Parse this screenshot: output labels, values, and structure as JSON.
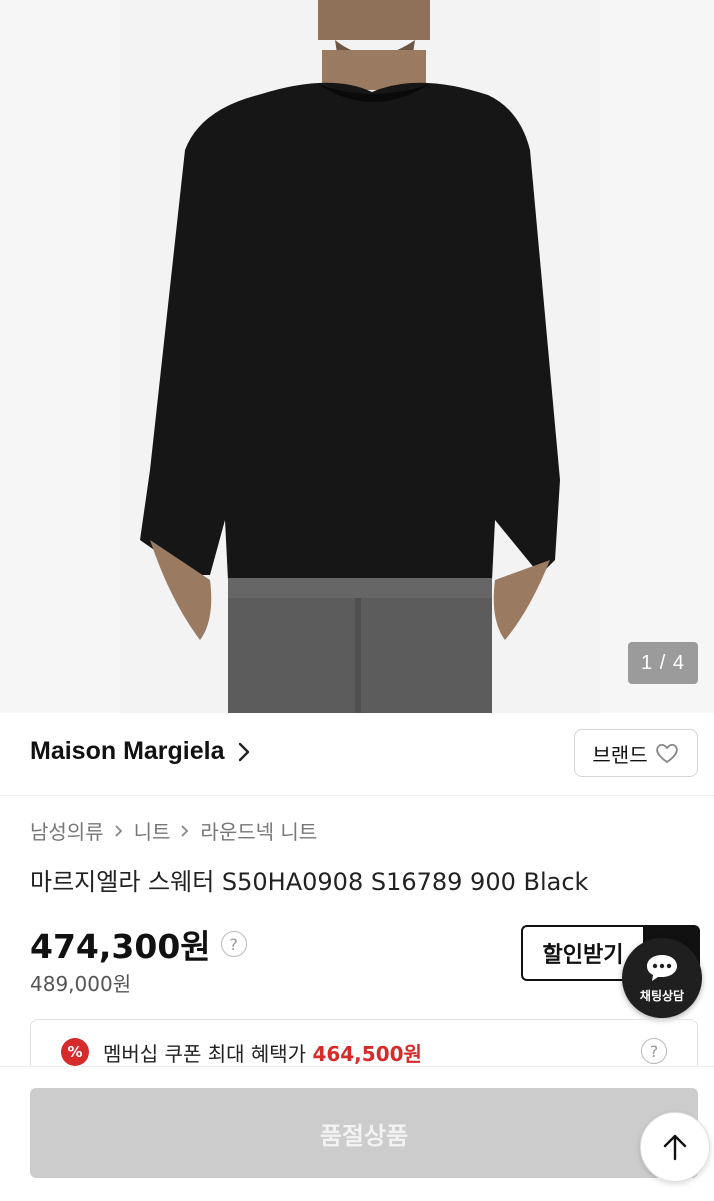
{
  "gallery": {
    "counter": "1 / 4"
  },
  "brand": {
    "name": "Maison Margiela",
    "button_label": "브랜드"
  },
  "breadcrumb": [
    "남성의류",
    "니트",
    "라운드넥 니트"
  ],
  "product": {
    "title": "마르지엘라 스웨터 S50HA0908 S16789 900 Black",
    "price": "474,300원",
    "original_price": "489,000원",
    "discount_button": "할인받기"
  },
  "coupon": {
    "icon_text": "%",
    "label": "멤버십 쿠폰 최대 혜택가",
    "price": "464,500원"
  },
  "chat": {
    "label": "채팅상담"
  },
  "help_glyph": "?",
  "purchase": {
    "label": "품절상품"
  },
  "colors": {
    "accent": "#d62b2b",
    "disabled": "#cccccc"
  },
  "icons": [
    "chevron-right-icon",
    "heart-icon",
    "help-icon",
    "percent-icon",
    "chat-icon",
    "arrow-up-icon"
  ]
}
